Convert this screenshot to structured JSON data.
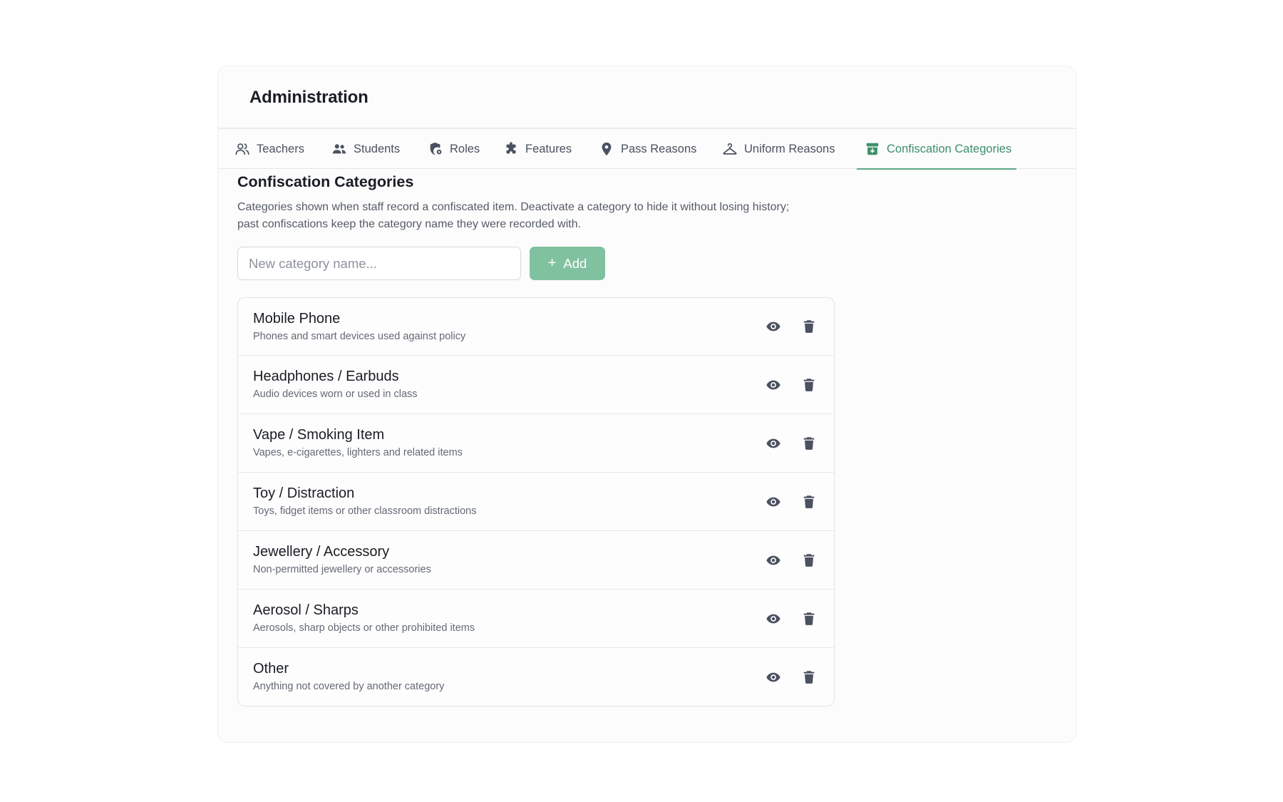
{
  "page": {
    "title": "Administration"
  },
  "tabs": [
    {
      "label": "Teachers",
      "icon": "users-outline-icon",
      "active": false
    },
    {
      "label": "Students",
      "icon": "users-icon",
      "active": false
    },
    {
      "label": "Roles",
      "icon": "shield-gear-icon",
      "active": false
    },
    {
      "label": "Features",
      "icon": "puzzle-icon",
      "active": false
    },
    {
      "label": "Pass Reasons",
      "icon": "map-pin-icon",
      "active": false
    },
    {
      "label": "Uniform Reasons",
      "icon": "hanger-icon",
      "active": false
    },
    {
      "label": "Confiscation Categories",
      "icon": "archive-box-icon",
      "active": true
    }
  ],
  "section": {
    "title": "Confiscation Categories",
    "description_line1": "Categories shown when staff record a confiscated item. Deactivate a category to hide it without losing history;",
    "description_line2": "past confiscations keep the category name they were recorded with."
  },
  "add_form": {
    "placeholder": "New category name...",
    "value": "",
    "button_label": "Add",
    "button_icon": "plus-icon"
  },
  "categories": [
    {
      "name": "Mobile Phone",
      "description": "Phones and smart devices used against policy"
    },
    {
      "name": "Headphones / Earbuds",
      "description": "Audio devices worn or used in class"
    },
    {
      "name": "Vape / Smoking Item",
      "description": "Vapes, e-cigarettes, lighters and related items"
    },
    {
      "name": "Toy / Distraction",
      "description": "Toys, fidget items or other classroom distractions"
    },
    {
      "name": "Jewellery / Accessory",
      "description": "Non-permitted jewellery or accessories"
    },
    {
      "name": "Aerosol / Sharps",
      "description": "Aerosols, sharp objects or other prohibited items"
    },
    {
      "name": "Other",
      "description": "Anything not covered by another category"
    }
  ],
  "row_actions": {
    "visibility_icon": "eye-icon",
    "delete_icon": "trash-icon"
  },
  "colors": {
    "accent": "#3d8f6a",
    "add_button": "#80c19f",
    "text": "#1a1d24",
    "muted": "#636975"
  }
}
